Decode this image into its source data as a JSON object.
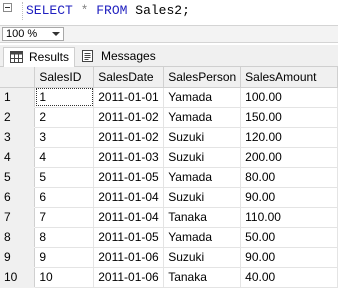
{
  "editor": {
    "tokens": {
      "select": "SELECT",
      "star": "*",
      "from": "FROM",
      "table": "Sales2;"
    }
  },
  "zoom": {
    "value": "100 %"
  },
  "tabs": {
    "results": "Results",
    "messages": "Messages",
    "active": "Results"
  },
  "grid": {
    "columns": [
      "SalesID",
      "SalesDate",
      "SalesPerson",
      "SalesAmount"
    ],
    "rows": [
      {
        "num": "1",
        "cells": [
          "1",
          "2011-01-01",
          "Yamada",
          "100.00"
        ]
      },
      {
        "num": "2",
        "cells": [
          "2",
          "2011-01-02",
          "Yamada",
          "150.00"
        ]
      },
      {
        "num": "3",
        "cells": [
          "3",
          "2011-01-02",
          "Suzuki",
          "120.00"
        ]
      },
      {
        "num": "4",
        "cells": [
          "4",
          "2011-01-03",
          "Suzuki",
          "200.00"
        ]
      },
      {
        "num": "5",
        "cells": [
          "5",
          "2011-01-05",
          "Yamada",
          "80.00"
        ]
      },
      {
        "num": "6",
        "cells": [
          "6",
          "2011-01-04",
          "Suzuki",
          "90.00"
        ]
      },
      {
        "num": "7",
        "cells": [
          "7",
          "2011-01-04",
          "Tanaka",
          "110.00"
        ]
      },
      {
        "num": "8",
        "cells": [
          "8",
          "2011-01-05",
          "Yamada",
          "50.00"
        ]
      },
      {
        "num": "9",
        "cells": [
          "9",
          "2011-01-06",
          "Suzuki",
          "90.00"
        ]
      },
      {
        "num": "10",
        "cells": [
          "10",
          "2011-01-06",
          "Tanaka",
          "40.00"
        ]
      }
    ]
  },
  "colors": {
    "keyword": "#1f1fbf",
    "operator": "#7f7f7f"
  }
}
